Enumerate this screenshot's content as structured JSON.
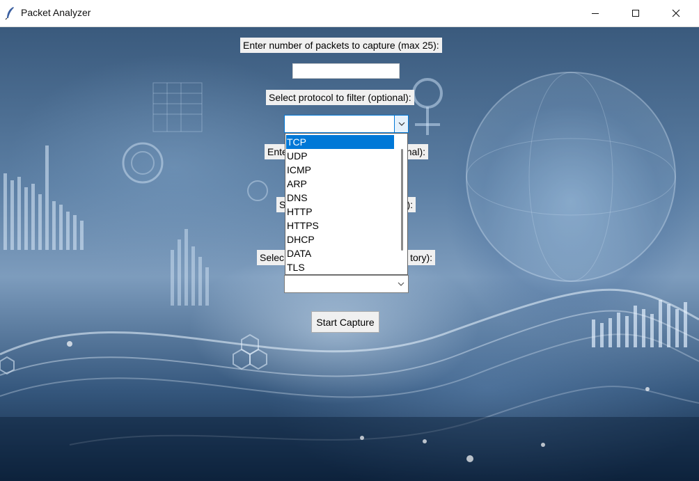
{
  "window": {
    "title": "Packet Analyzer",
    "controls": [
      "minimize-icon",
      "maximize-icon",
      "close-icon"
    ]
  },
  "form": {
    "packet_count_label": "Enter number of packets to capture (max 25):",
    "packet_count_value": "",
    "protocol_label": "Select protocol to filter (optional):",
    "protocol_value": "",
    "label_3_visible_left": "Ente",
    "label_3_visible_right": "nal):",
    "label_4_visible_left": "S",
    "label_4_visible_right": "):",
    "label_5_visible_left": "Selec",
    "label_5_visible_right": "tory):",
    "combo_2_value": "",
    "start_button": "Start Capture"
  },
  "protocol_options": [
    "TCP",
    "UDP",
    "ICMP",
    "ARP",
    "DNS",
    "HTTP",
    "HTTPS",
    "DHCP",
    "DATA",
    "TLS"
  ],
  "selected_option": "TCP",
  "colors": {
    "selection": "#0078d7",
    "label_bg": "#f0f0f0"
  }
}
